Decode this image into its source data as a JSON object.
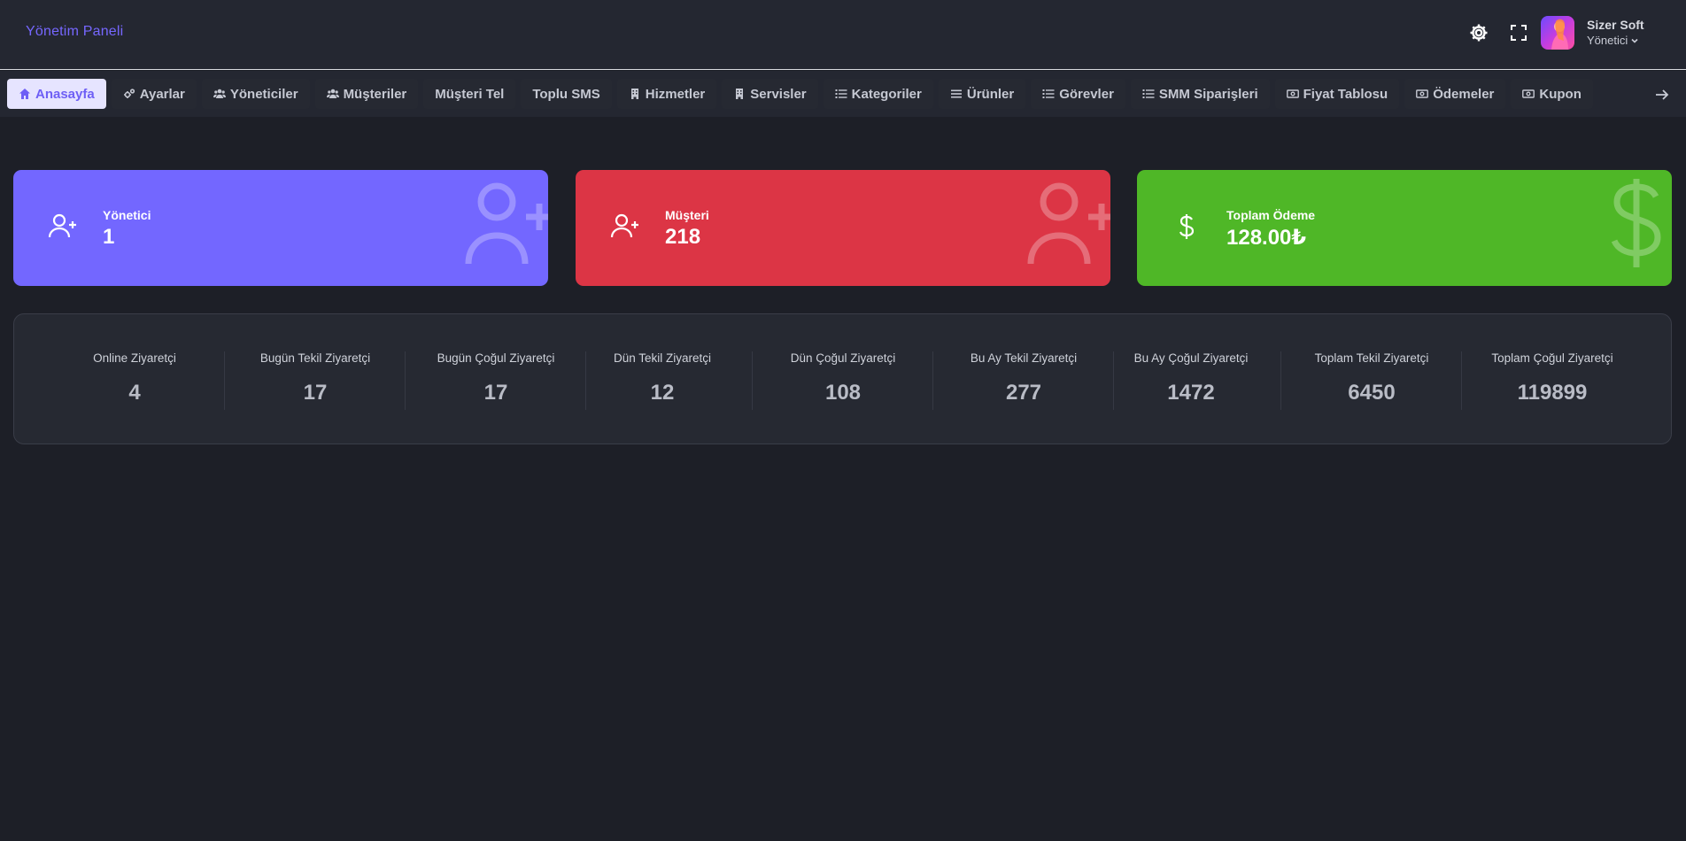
{
  "header": {
    "brand": "Yönetim Paneli",
    "user_name": "Sizer Soft",
    "user_role": "Yönetici"
  },
  "nav": {
    "items": [
      {
        "label": "Anasayfa",
        "icon": "home-icon",
        "active": true
      },
      {
        "label": "Ayarlar",
        "icon": "cogs-icon"
      },
      {
        "label": "Yöneticiler",
        "icon": "users-icon"
      },
      {
        "label": "Müşteriler",
        "icon": "users-icon"
      },
      {
        "label": "Müşteri Tel",
        "icon": ""
      },
      {
        "label": "Toplu SMS",
        "icon": ""
      },
      {
        "label": "Hizmetler",
        "icon": "building-icon"
      },
      {
        "label": "Servisler",
        "icon": "building-icon"
      },
      {
        "label": "Kategoriler",
        "icon": "list-icon"
      },
      {
        "label": "Ürünler",
        "icon": "bars-icon"
      },
      {
        "label": "Görevler",
        "icon": "list-icon"
      },
      {
        "label": "SMM Siparişleri",
        "icon": "list-icon"
      },
      {
        "label": "Fiyat Tablosu",
        "icon": "money-icon"
      },
      {
        "label": "Ödemeler",
        "icon": "money-icon"
      },
      {
        "label": "Kupon",
        "icon": "money-icon"
      }
    ]
  },
  "cards": {
    "admin": {
      "label": "Yönetici",
      "value": "1",
      "color": "#7367ff"
    },
    "customer": {
      "label": "Müşteri",
      "value": "218",
      "color": "#dc3545"
    },
    "payment": {
      "label": "Toplam Ödeme",
      "value": "128.00₺",
      "color": "#4fb727"
    }
  },
  "visitors": [
    {
      "label": "Online Ziyaretçi",
      "value": "4"
    },
    {
      "label": "Bugün Tekil Ziyaretçi",
      "value": "17"
    },
    {
      "label": "Bugün Çoğul Ziyaretçi",
      "value": "17"
    },
    {
      "label": "Dün Tekil Ziyaretçi",
      "value": "12"
    },
    {
      "label": "Dün Çoğul Ziyaretçi",
      "value": "108"
    },
    {
      "label": "Bu Ay Tekil Ziyaretçi",
      "value": "277"
    },
    {
      "label": "Bu Ay Çoğul Ziyaretçi",
      "value": "1472"
    },
    {
      "label": "Toplam Tekil Ziyaretçi",
      "value": "6450"
    },
    {
      "label": "Toplam Çoğul Ziyaretçi",
      "value": "119899"
    }
  ]
}
